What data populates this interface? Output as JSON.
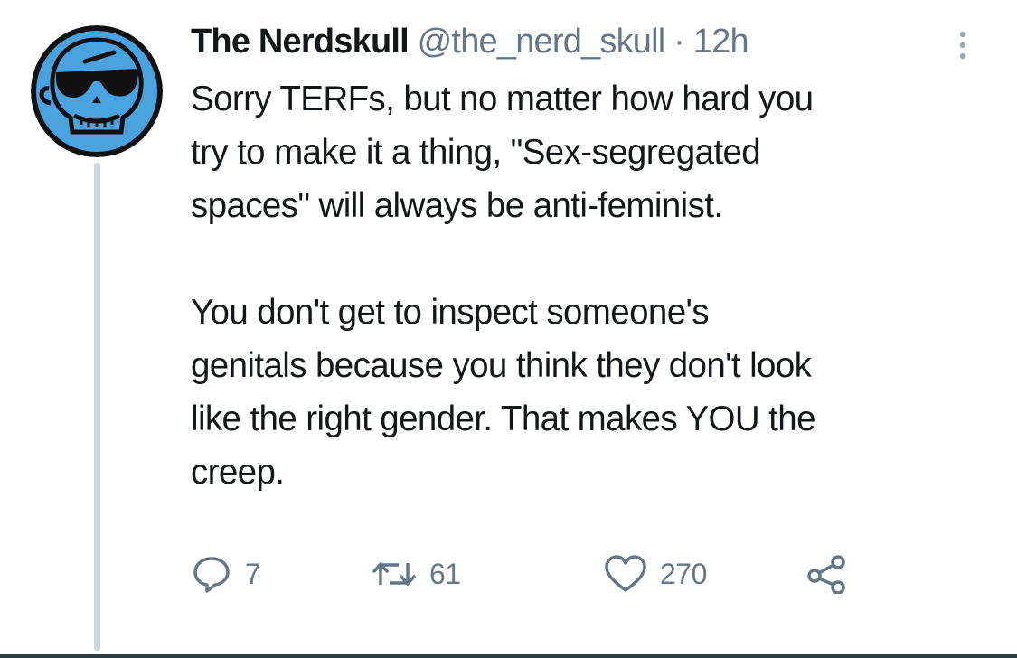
{
  "tweet": {
    "display_name": "The Nerdskull",
    "handle": "@the_nerd_skull",
    "separator": "·",
    "time": "12h",
    "paragraphs": [
      "Sorry TERFs, but no matter how hard you\ntry to make it a thing, \"Sex-segregated\nspaces\" will always be anti-feminist.",
      "You don't get to inspect someone's\ngenitals because you think they don't look\nlike the right gender. That makes YOU the\ncreep."
    ],
    "reply_count": "7",
    "retweet_count": "61",
    "like_count": "270"
  },
  "icons": {
    "avatar": "skull-with-sunglasses-avatar",
    "more": "more-vertical-icon",
    "reply": "reply-icon",
    "retweet": "retweet-icon",
    "like": "heart-icon",
    "share": "share-icon"
  },
  "colors": {
    "text": "#14171a",
    "secondary": "#657786",
    "avatar_blue": "#4aa3df",
    "thread_line": "#cfd6dc"
  }
}
